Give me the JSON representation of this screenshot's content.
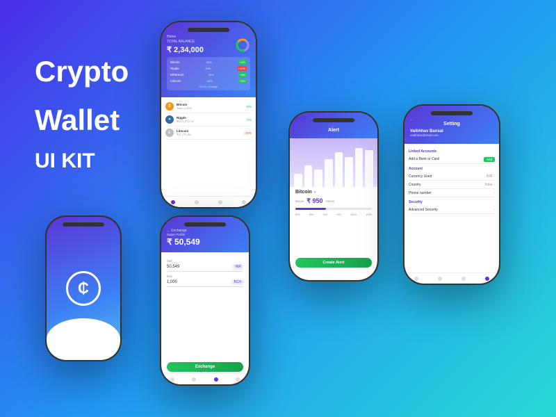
{
  "hero": {
    "line1": "Crypto",
    "line2": "Wallet",
    "line3": "UI KIT"
  },
  "home": {
    "header_label": "TOTAL BALANCE",
    "balance": "₹ 2,34,000",
    "crypto_list": [
      {
        "name": "Bitcoin",
        "pct": "22%",
        "change": "+4%",
        "positive": true
      },
      {
        "name": "Ripple",
        "pct": "33%",
        "change": "+10%",
        "positive": false
      },
      {
        "name": "Ethereum",
        "pct": "22%",
        "change": "+6%",
        "positive": true
      },
      {
        "name": "Litecoin",
        "pct": "44%",
        "change": "+5%",
        "positive": true
      }
    ],
    "assets": [
      {
        "name": "Bitcoin",
        "sub": "₹21 - 1.825",
        "change": "↑5%",
        "color": "#f7931a"
      },
      {
        "name": "Ripple",
        "sub": "₹112 - ₹72.25",
        "change": "↑2%",
        "color": "#346aa9"
      },
      {
        "name": "Litecoin",
        "sub": "₹21 - ₹1.85",
        "change": "↓20%",
        "color": "#bebebe"
      }
    ]
  },
  "exchange": {
    "title": "Exchange",
    "super_profits_label": "Super Profits",
    "amount": "₹ 50,549",
    "sell_label": "Sell",
    "sell_value": "50,549",
    "sell_currency": "INR",
    "buy_label": "Buy",
    "buy_value": "1,000",
    "buy_currency": "BCH",
    "btn_label": "Exchange"
  },
  "alert": {
    "title": "Alert",
    "chart_label": "Bit Coin",
    "coin_name": "Bitcoin",
    "below_label": "Below",
    "price": "₹ 950",
    "above_label": "Above",
    "btn_label": "Create Alert",
    "bars": [
      30,
      50,
      40,
      65,
      80,
      70,
      90,
      85
    ]
  },
  "settings": {
    "title": "Setting",
    "user_name": "Vaibhhav Bansal",
    "user_email": "vaibhhav@mail.com",
    "linked_accounts_label": "Linked Accounts",
    "add_bank_label": "Add a Bank or Card",
    "add_btn": "Add",
    "account_label": "Account",
    "currency_label": "Currency Used",
    "currency_value": "INR",
    "country_label": "Country",
    "country_value": "India",
    "phone_label": "Phone number",
    "security_label": "Security",
    "advanced_security_label": "Advanced Security"
  }
}
